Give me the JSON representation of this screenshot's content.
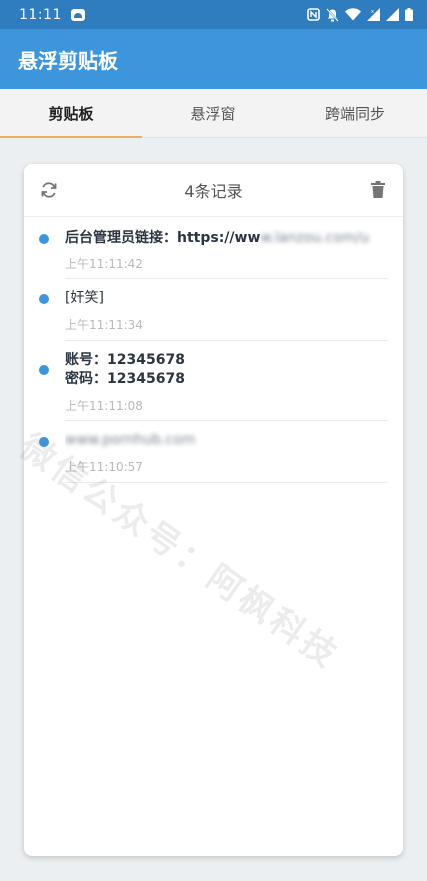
{
  "status_bar": {
    "time": "11:11"
  },
  "app_bar": {
    "title": "悬浮剪贴板"
  },
  "tabs": [
    {
      "label": "剪贴板",
      "active": true
    },
    {
      "label": "悬浮窗",
      "active": false
    },
    {
      "label": "跨端同步",
      "active": false
    }
  ],
  "card": {
    "header_title": "4条记录",
    "records": [
      {
        "prefix": "后台管理员链接：https://ww",
        "blurred": "w.lanzou.com/u",
        "time": "上午11:11:42"
      },
      {
        "text": "[奸笑]",
        "time": "上午11:11:34"
      },
      {
        "line1": "账号：12345678",
        "line2": "密码：12345678",
        "time": "上午11:11:08"
      },
      {
        "blurred": "www.pornhub.com",
        "time": "上午11:10:57"
      }
    ]
  },
  "watermark": "微信公众号：阿枫科技",
  "colors": {
    "status_bar": "#2f7cbf",
    "app_bar": "#3d95dc",
    "tab_indicator": "#e9b15a",
    "dot": "#3d95dc"
  }
}
